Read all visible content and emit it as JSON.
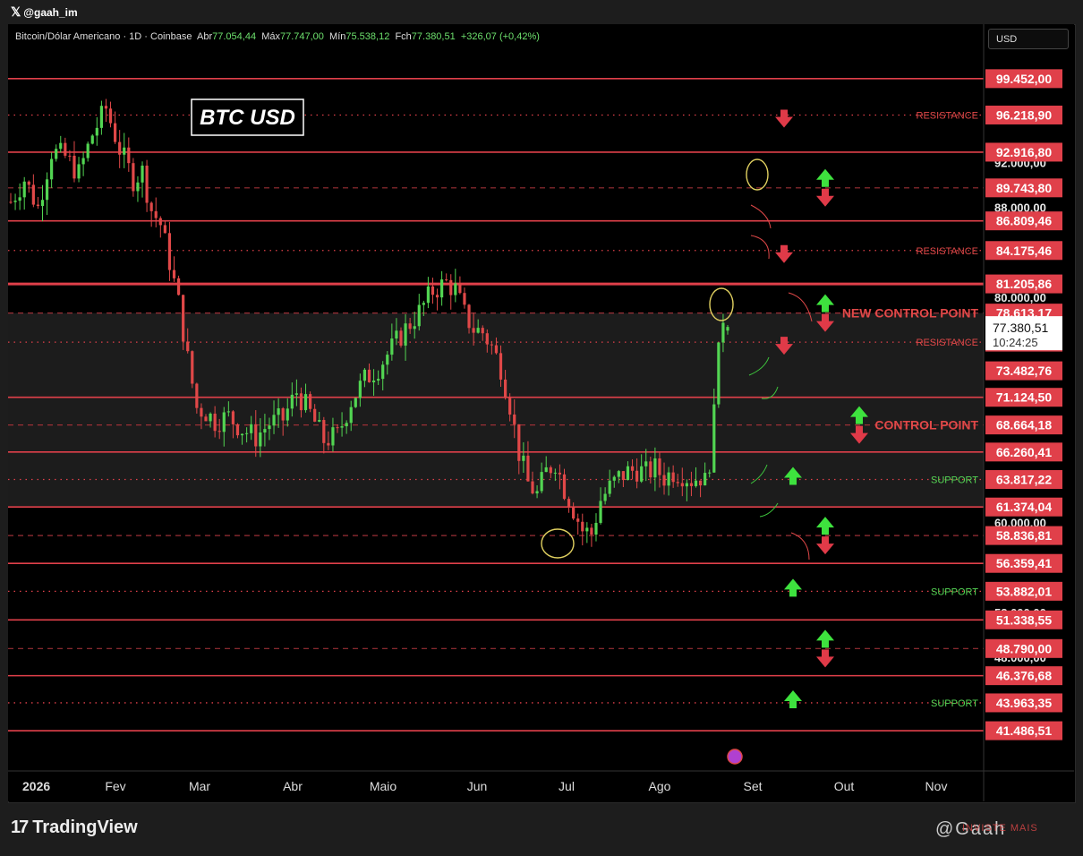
{
  "header": {
    "handle": "@gaah_im"
  },
  "symbol": {
    "name": "Bitcoin/Dólar Americano · 1D · Coinbase",
    "open_label": "Abr",
    "open": "77.054,44",
    "high_label": "Máx",
    "high": "77.747,00",
    "low_label": "Mín",
    "low": "75.538,12",
    "close_label": "Fch",
    "close": "77.380,51",
    "change": "+326,07 (+0,42%)"
  },
  "currency": "USD",
  "overlay_title": "BTC USD",
  "footer": {
    "brand": "TradingView",
    "watermark": "@Gaah",
    "watermark_red": "INVISTE MAIS"
  },
  "colors": {
    "background": "#000000",
    "level_red": "#e0404a",
    "up": "#52d552",
    "down": "#e04848",
    "zone": "#1c1c1c",
    "circle": "#e0d060"
  },
  "chart_data": {
    "type": "candlestick",
    "x_axis": [
      "2026",
      "Fev",
      "Mar",
      "Abr",
      "Maio",
      "Jun",
      "Jul",
      "Ago",
      "Set",
      "Out",
      "Nov"
    ],
    "ylim": [
      39900,
      101000
    ],
    "price_path": [
      [
        0,
        88500
      ],
      [
        3,
        90500
      ],
      [
        6,
        88000
      ],
      [
        9,
        93000
      ],
      [
        12,
        92500
      ],
      [
        15,
        91000
      ],
      [
        18,
        94500
      ],
      [
        21,
        96800
      ],
      [
        24,
        93200
      ],
      [
        27,
        90500
      ],
      [
        29,
        91200
      ],
      [
        31,
        87800
      ],
      [
        33,
        86500
      ],
      [
        35,
        83200
      ],
      [
        37,
        79500
      ],
      [
        39,
        74500
      ],
      [
        41,
        70200
      ],
      [
        43,
        69800
      ],
      [
        45,
        69000
      ],
      [
        48,
        69400
      ],
      [
        51,
        68300
      ],
      [
        54,
        67600
      ],
      [
        57,
        68800
      ],
      [
        60,
        69200
      ],
      [
        63,
        71600
      ],
      [
        66,
        69700
      ],
      [
        69,
        67300
      ],
      [
        72,
        67700
      ],
      [
        75,
        70800
      ],
      [
        78,
        72700
      ],
      [
        81,
        73800
      ],
      [
        84,
        75500
      ],
      [
        87,
        77200
      ],
      [
        90,
        78700
      ],
      [
        93,
        80600
      ],
      [
        96,
        81300
      ],
      [
        98,
        80700
      ],
      [
        100,
        78500
      ],
      [
        102,
        77200
      ],
      [
        104,
        76900
      ],
      [
        106,
        75600
      ],
      [
        108,
        73800
      ],
      [
        110,
        70500
      ],
      [
        112,
        66200
      ],
      [
        114,
        63500
      ],
      [
        116,
        62500
      ],
      [
        118,
        64500
      ],
      [
        120,
        65400
      ],
      [
        122,
        63000
      ],
      [
        124,
        61200
      ],
      [
        126,
        59300
      ],
      [
        128,
        59000
      ],
      [
        130,
        62000
      ],
      [
        132,
        63100
      ],
      [
        134,
        64000
      ],
      [
        136,
        64500
      ],
      [
        138,
        64700
      ],
      [
        140,
        64400
      ],
      [
        142,
        64800
      ],
      [
        144,
        64000
      ],
      [
        146,
        64500
      ],
      [
        148,
        64300
      ],
      [
        150,
        63800
      ],
      [
        152,
        64100
      ],
      [
        153,
        63600
      ],
      [
        154,
        65500
      ],
      [
        155,
        70500
      ],
      [
        156,
        76000
      ],
      [
        157,
        77750
      ],
      [
        158,
        77380
      ]
    ],
    "levels": [
      {
        "price": 99452.0,
        "label": "99.452,00",
        "style": "solid"
      },
      {
        "price": 96218.9,
        "label": "96.218,90",
        "style": "dotted",
        "tag": "RESISTANCE",
        "tag_color": "red"
      },
      {
        "price": 92916.8,
        "label": "92.916,80",
        "style": "solid"
      },
      {
        "price": 89743.8,
        "label": "89.743,80",
        "style": "dashed"
      },
      {
        "price": 86809.46,
        "label": "86.809,46",
        "style": "solid"
      },
      {
        "price": 84175.46,
        "label": "84.175,46",
        "style": "dotted",
        "tag": "RESISTANCE",
        "tag_color": "red"
      },
      {
        "price": 81205.86,
        "label": "81.205,86",
        "style": "solid-thick"
      },
      {
        "price": 78613.17,
        "label": "78.613,17",
        "style": "dashed",
        "tag": "NEW CONTROL POINT",
        "tag_color": "red",
        "tag_big": true
      },
      {
        "price": 76029.35,
        "label": "76.029,35",
        "style": "dotted",
        "tag": "RESISTANCE",
        "tag_color": "red"
      },
      {
        "price": 73482.76,
        "label": "73.482,76",
        "style": "none"
      },
      {
        "price": 71124.5,
        "label": "71.124,50",
        "style": "solid"
      },
      {
        "price": 68664.18,
        "label": "68.664,18",
        "style": "dashed",
        "tag": "CONTROL POINT",
        "tag_color": "red",
        "tag_big": true
      },
      {
        "price": 66260.41,
        "label": "66.260,41",
        "style": "solid"
      },
      {
        "price": 63817.22,
        "label": "63.817,22",
        "style": "dotted",
        "tag": "SUPPORT",
        "tag_color": "green"
      },
      {
        "price": 61374.04,
        "label": "61.374,04",
        "style": "solid"
      },
      {
        "price": 58836.81,
        "label": "58.836,81",
        "style": "dashed"
      },
      {
        "price": 56359.41,
        "label": "56.359,41",
        "style": "solid"
      },
      {
        "price": 53882.01,
        "label": "53.882,01",
        "style": "dotted",
        "tag": "SUPPORT",
        "tag_color": "green"
      },
      {
        "price": 51338.55,
        "label": "51.338,55",
        "style": "solid"
      },
      {
        "price": 48790.0,
        "label": "48.790,00",
        "style": "dashed"
      },
      {
        "price": 46376.68,
        "label": "46.376,68",
        "style": "solid"
      },
      {
        "price": 43963.35,
        "label": "43.963,35",
        "style": "dotted",
        "tag": "SUPPORT",
        "tag_color": "green"
      },
      {
        "price": 41486.51,
        "label": "41.486,51",
        "style": "solid"
      }
    ],
    "round_labels": [
      {
        "price": 92000,
        "label": "92.000,00"
      },
      {
        "price": 88000,
        "label": "88.000,00"
      },
      {
        "price": 80000,
        "label": "80.000,00"
      },
      {
        "price": 60000,
        "label": "60.000,00"
      },
      {
        "price": 52000,
        "label": "52.000,00"
      },
      {
        "price": 48000,
        "label": "48.000,00"
      }
    ],
    "current_price": {
      "price": 77380.51,
      "label": "77.380,51",
      "countdown": "10:24:25"
    },
    "zones": [
      [
        61374.04,
        78613.17
      ]
    ],
    "arrows": [
      {
        "price": 96218.9,
        "dir": "down"
      },
      {
        "price": 89743.8,
        "dir": "both"
      },
      {
        "price": 84175.46,
        "dir": "down"
      },
      {
        "price": 78613.17,
        "dir": "both"
      },
      {
        "price": 76029.35,
        "dir": "down"
      },
      {
        "price": 68664.18,
        "dir": "both"
      },
      {
        "price": 63817.22,
        "dir": "up"
      },
      {
        "price": 58836.81,
        "dir": "both"
      },
      {
        "price": 53882.01,
        "dir": "up"
      },
      {
        "price": 48790.0,
        "dir": "both"
      },
      {
        "price": 43963.35,
        "dir": "up"
      }
    ]
  }
}
